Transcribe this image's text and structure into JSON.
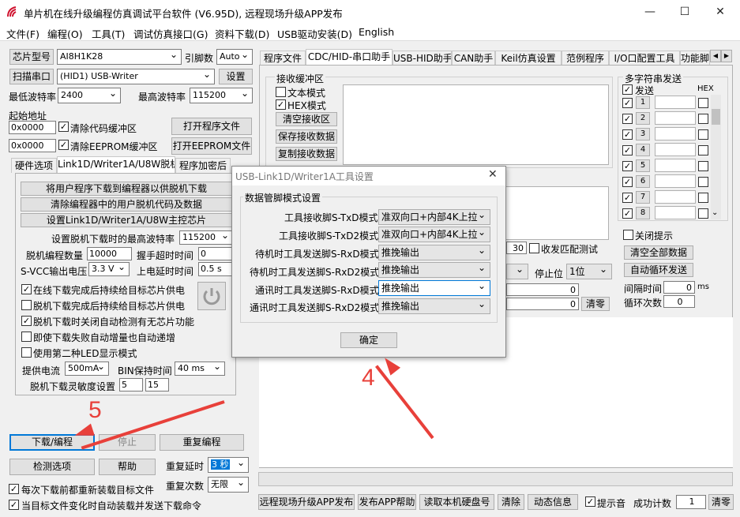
{
  "window": {
    "title": "单片机在线升级编程仿真调试平台软件 (V6.95D), 远程现场升级APP发布"
  },
  "menu": [
    "文件(F)",
    "编程(O)",
    "工具(T)",
    "调试仿真接口(G)",
    "资料下载(D)",
    "USB驱动安装(D)",
    "English"
  ],
  "left": {
    "chip_btn": "芯片型号",
    "chip_value": "AI8H1K28",
    "pins_label": "引脚数",
    "pins_value": "Auto",
    "scan_btn": "扫描串口",
    "port_value": "(HID1) USB-Writer",
    "settings_btn": "设置",
    "min_baud_label": "最低波特率",
    "min_baud_value": "2400",
    "max_baud_label": "最高波特率",
    "max_baud_value": "115200",
    "start_addr_label": "起始地址",
    "addr1": "0x0000",
    "clear_code_label": "清除代码缓冲区",
    "open_prog_btn": "打开程序文件",
    "addr2": "0x0000",
    "clear_eeprom_label": "清除EEPROM缓冲区",
    "open_eeprom_btn": "打开EEPROM文件",
    "tabs": [
      "硬件选项",
      "Link1D/Writer1A/U8W脱机",
      "程序加密后"
    ],
    "offline": {
      "btn1": "将用户程序下载到编程器以供脱机下载",
      "btn2": "清除编程器中的用户脱机代码及数据",
      "btn3": "设置Link1D/Writer1A/U8W主控芯片",
      "max_baud_label": "设置脱机下载时的最高波特率",
      "max_baud_value": "115200",
      "prog_count_label": "脱机编程数量",
      "prog_count_value": "10000",
      "handshake_label": "握手超时时间",
      "handshake_value": "0",
      "vcc_label": "S-VCC输出电压",
      "vcc_value": "3.3 V",
      "delay_label": "上电延时时间",
      "delay_value": "0.5 s",
      "checks": [
        {
          "label": "在线下载完成后持续给目标芯片供电",
          "on": true
        },
        {
          "label": "脱机下载完成后持续给目标芯片供电",
          "on": false
        },
        {
          "label": "脱机下载时关闭自动检测有无芯片功能",
          "on": true
        },
        {
          "label": "即使下载失败自动增量也自动递增",
          "on": false
        },
        {
          "label": "使用第二种LED显示模式",
          "on": false
        }
      ],
      "current_label": "提供电流",
      "current_value": "500mA",
      "bin_label": "BIN保持时间",
      "bin_value": "40 ms",
      "sensitivity_label": "脱机下载灵敏度设置",
      "sens1": "5",
      "sens2": "15"
    },
    "download_btn": "下载/编程",
    "stop_btn": "停止",
    "reprogram_btn": "重复编程",
    "detect_btn": "检测选项",
    "help_btn": "帮助",
    "repeat_delay_label": "重复延时",
    "repeat_delay_value": "3 秒",
    "repeat_count_label": "重复次数",
    "repeat_count_value": "无限",
    "reload_label": "每次下载前都重新装载目标文件",
    "auto_label": "当目标文件变化时自动装载并发送下载命令"
  },
  "right": {
    "tabs": [
      "程序文件",
      "CDC/HID-串口助手",
      "USB-HID助手",
      "CAN助手",
      "Keil仿真设置",
      "范例程序",
      "I/O口配置工具",
      "功能脚"
    ],
    "recv_group": "接收缓冲区",
    "text_mode": "文本模式",
    "hex_mode": "HEX模式",
    "clear_recv": "清空接收区",
    "save_recv": "保存接收数据",
    "copy_recv": "复制接收数据",
    "multi_group": "多字符串发送",
    "send_hdr": "发送",
    "hex_hdr": "HEX",
    "rows": [
      "1",
      "2",
      "3",
      "4",
      "5",
      "6",
      "7",
      "8"
    ],
    "close_tip": "关闭提示",
    "clear_all": "清空全部数据",
    "auto_loop": "自动循环发送",
    "interval_label": "间隔时间",
    "interval_value": "0",
    "interval_unit": "ms",
    "loop_label": "循环次数",
    "loop_value": "0",
    "val30": "30",
    "recv_match": "收发匹配测试",
    "stop_bit_label": "停止位",
    "stop_bit_value": "1位",
    "cnt1": "0",
    "cnt2": "0",
    "clear_cnt": "清零",
    "bottom": {
      "remote_btn": "远程现场升级APP发布",
      "publish_help": "发布APP帮助",
      "read_disk": "读取本机硬盘号",
      "clear_btn": "清除",
      "dynamic": "动态信息",
      "tip_sound": "提示音",
      "success_label": "成功计数",
      "success_value": "1",
      "zero_btn": "清零"
    }
  },
  "dialog": {
    "title": "USB-Link1D/Writer1A工具设置",
    "group": "数据管脚模式设置",
    "rows": [
      {
        "label": "工具接收脚S-TxD模式",
        "value": "准双向口+内部4K上拉"
      },
      {
        "label": "工具接收脚S-TxD2模式",
        "value": "准双向口+内部4K上拉"
      },
      {
        "label": "待机时工具发送脚S-RxD模式",
        "value": "推挽输出"
      },
      {
        "label": "待机时工具发送脚S-RxD2模式",
        "value": "推挽输出"
      },
      {
        "label": "通讯时工具发送脚S-RxD模式",
        "value": "推挽输出"
      },
      {
        "label": "通讯时工具发送脚S-RxD2模式",
        "value": "推挽输出"
      }
    ],
    "ok_btn": "确定"
  },
  "annotations": {
    "step4": "4",
    "step5": "5"
  },
  "colors": {
    "accent": "#0078d7",
    "annotation": "#e8403a"
  }
}
